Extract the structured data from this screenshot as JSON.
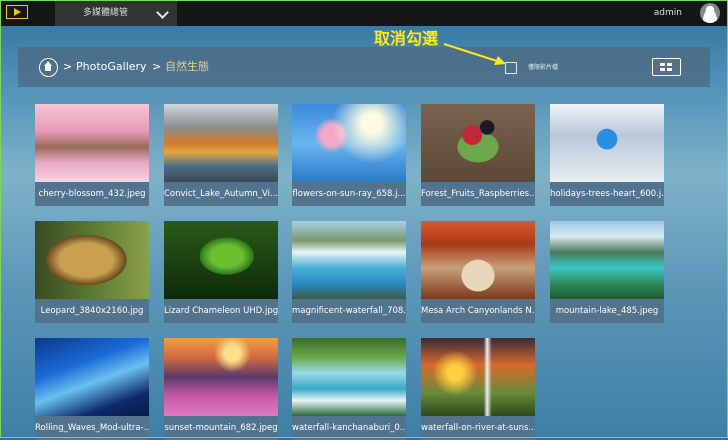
{
  "topbar": {
    "dropdown_label": "多媒體總管",
    "user": "admin"
  },
  "breadcrumb": {
    "root": "PhotoGallery",
    "current": "自然生態",
    "separator": ">"
  },
  "filter": {
    "label": "僅限影片檔"
  },
  "annotation": {
    "text": "取消勾選"
  },
  "photos": [
    {
      "caption": "cherry-blossom_432.jpeg"
    },
    {
      "caption": "Convict_Lake_Autumn_Vi..."
    },
    {
      "caption": "flowers-on-sun-ray_658.j..."
    },
    {
      "caption": "Forest_Fruits_Raspberries..."
    },
    {
      "caption": "holidays-trees-heart_600.j..."
    },
    {
      "caption": "Leopard_3840x2160.jpg"
    },
    {
      "caption": "Lizard Chameleon UHD.jpg"
    },
    {
      "caption": "magnificent-waterfall_708..."
    },
    {
      "caption": "Mesa Arch Canyonlands N..."
    },
    {
      "caption": "mountain-lake_485.jpeg"
    },
    {
      "caption": "Rolling_Waves_Mod-ultra-..."
    },
    {
      "caption": "sunset-mountain_682.jpeg"
    },
    {
      "caption": "waterfall-kanchanaburi_0..."
    },
    {
      "caption": "waterfall-on-river-at-suns..."
    }
  ]
}
